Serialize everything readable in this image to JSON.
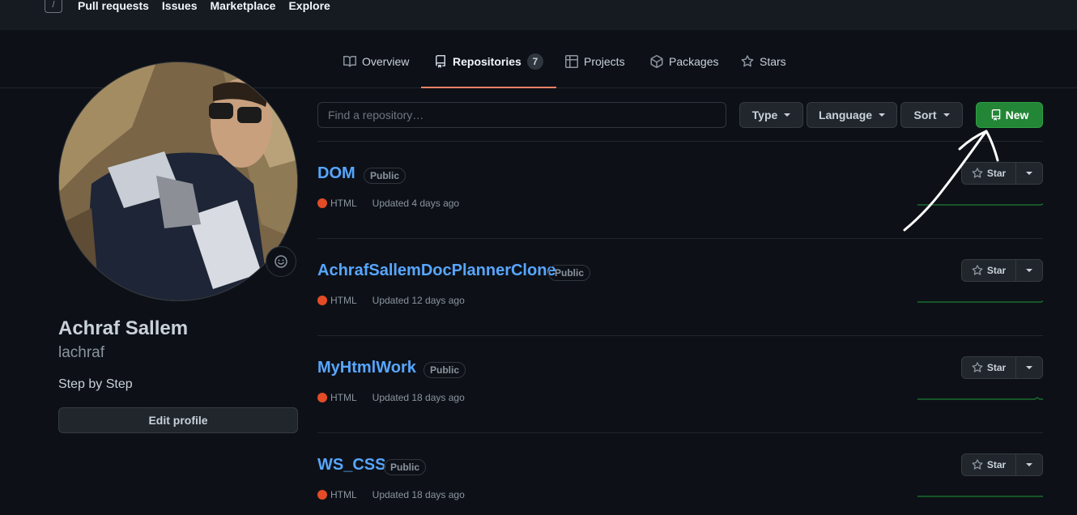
{
  "topbar": {
    "slash_key": "/",
    "nav": [
      "Pull requests",
      "Issues",
      "Marketplace",
      "Explore"
    ]
  },
  "tabs": [
    {
      "label": "Overview",
      "icon": "book-icon"
    },
    {
      "label": "Repositories",
      "icon": "repo-icon",
      "count": "7",
      "selected": true
    },
    {
      "label": "Projects",
      "icon": "table-icon"
    },
    {
      "label": "Packages",
      "icon": "package-icon"
    },
    {
      "label": "Stars",
      "icon": "star-icon"
    }
  ],
  "profile": {
    "full_name": "Achraf Sallem",
    "username": "lachraf",
    "bio": "Step by Step",
    "edit_label": "Edit profile",
    "status_icon": "smiley-icon"
  },
  "filters": {
    "search_placeholder": "Find a repository…",
    "type_label": "Type",
    "language_label": "Language",
    "sort_label": "Sort",
    "new_label": "New"
  },
  "repos": [
    {
      "name": "DOM",
      "visibility": "Public",
      "language": "HTML",
      "updated": "Updated 4 days ago",
      "star_label": "Star"
    },
    {
      "name": "AchrafSallemDocPlannerClone",
      "visibility": "Public",
      "language": "HTML",
      "updated": "Updated 12 days ago",
      "star_label": "Star"
    },
    {
      "name": "MyHtmlWork",
      "visibility": "Public",
      "language": "HTML",
      "updated": "Updated 18 days ago",
      "star_label": "Star"
    },
    {
      "name": "WS_CSS",
      "visibility": "Public",
      "language": "HTML",
      "updated": "Updated 18 days ago",
      "star_label": "Star"
    }
  ],
  "colors": {
    "accent_tab": "#f78166",
    "new_button": "#238636",
    "link": "#58a6ff",
    "html_lang": "#e34c26"
  }
}
